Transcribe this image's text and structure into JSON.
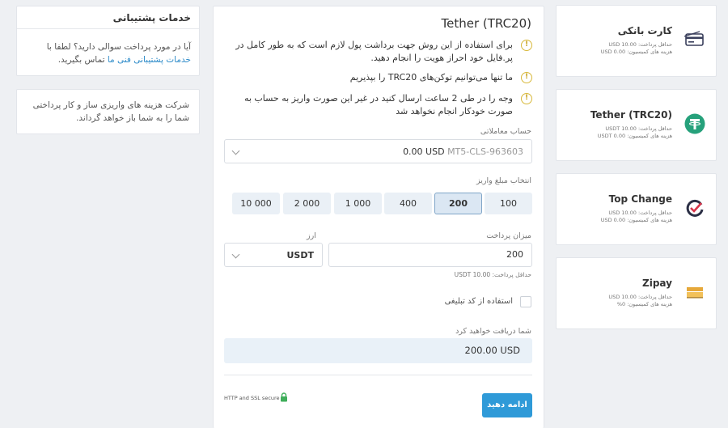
{
  "support": {
    "title": "خدمات پشتیبانی",
    "text_before": "آیا در مورد پرداخت سوالی دارید؟ لطفا با",
    "link": "خدمات پشتیبانی فنی ما",
    "text_after": "تماس بگیرید."
  },
  "refund_note": "شرکت هزینه های واریزی ساز و کار پرداختی شما را به شما باز خواهد گرداند.",
  "form": {
    "title": "Tether (TRC20)",
    "notes": [
      "برای استفاده از این روش جهت برداشت پول لازم است که به طور کامل در پر.فایل خود احراز هویت را انجام دهید.",
      "ما تنها می‌توانیم توکن‌های TRC20 را بپذیریم",
      "وجه را در طی 2 ساعت ارسال کنید در غیر این صورت واریز به حساب به صورت خودکار انجام نخواهد شد"
    ],
    "account_label": "حساب معاملاتی",
    "account_id": "MT5-CLS-963603",
    "account_balance": "0.00 USD",
    "amount_select_label": "انتخاب مبلغ واریز",
    "amounts": [
      "100",
      "200",
      "400",
      "1 000",
      "2 000",
      "10 000"
    ],
    "selected_amount": "200",
    "payment_amount_label": "میزان پرداخت",
    "payment_amount_value": "200",
    "currency_label": "ارز",
    "currency_value": "USDT",
    "min_payment_note": "حداقل پرداخت: 10.00 USDT",
    "promo_label": "استفاده از کد تبلیغی",
    "promo_checked": false,
    "receive_label": "شما دریافت خواهید کرد",
    "receive_value": "200.00 USD",
    "secure_text": "HTTP and SSL secure",
    "continue_label": "ادامه دهید"
  },
  "methods": [
    {
      "name": "کارت بانکی",
      "min": "حداقل پرداخت: 10.00 USD",
      "fee": "هزینه های کمیسیون: 0.00 USD",
      "icon": "bank-card-icon"
    },
    {
      "name": "Tether (TRC20)",
      "min": "حداقل پرداخت: 10.00 USDT",
      "fee": "هزینه های کمیسیون: 0.00 USDT",
      "icon": "tether-icon"
    },
    {
      "name": "Top Change",
      "min": "حداقل پرداخت: 10.00 USD",
      "fee": "هزینه های کمیسیون: 0.00 USD",
      "icon": "top-change-icon"
    },
    {
      "name": "Zipay",
      "min": "حداقل پرداخت: 10.00 USD",
      "fee": "هزینه های کمیسیون: 0%",
      "icon": "zipay-icon"
    }
  ],
  "colors": {
    "accent": "#2f9ad8",
    "tether": "#26a17b",
    "warning": "#d8b83a",
    "page_bg": "#eef0f3"
  }
}
